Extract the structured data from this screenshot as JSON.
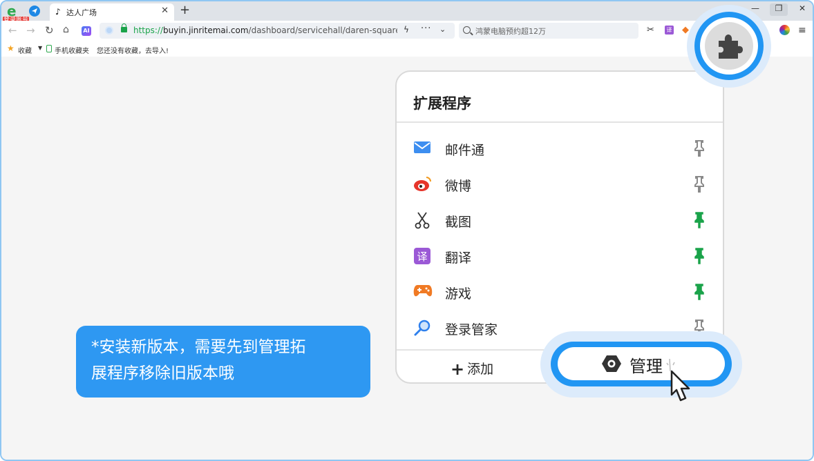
{
  "browser": {
    "login_badge": "登录账号",
    "tab": {
      "title": "达人广场"
    },
    "url": {
      "scheme": "https://",
      "host": "buyin.jinritemai.com",
      "path": "/dashboard/servicehall/daren-square?pre"
    },
    "search_query": "鸿蒙电脑预约超12万",
    "bookmarks": {
      "favorites": "收藏",
      "mobile": "手机收藏夹",
      "hint": "您还没有收藏，去导入!"
    }
  },
  "extensions_panel": {
    "title": "扩展程序",
    "items": [
      {
        "name": "邮件通",
        "icon": "mail-icon",
        "pinned": false
      },
      {
        "name": "微博",
        "icon": "weibo-icon",
        "pinned": false
      },
      {
        "name": "截图",
        "icon": "scissors-icon",
        "pinned": true
      },
      {
        "name": "翻译",
        "icon": "translate-icon",
        "pinned": true
      },
      {
        "name": "游戏",
        "icon": "gamepad-icon",
        "pinned": true
      },
      {
        "name": "登录管家",
        "icon": "key-icon",
        "pinned": false
      }
    ],
    "add_label": "添加",
    "manage_label": "管理"
  },
  "tooltip": {
    "line1": "*安装新版本，需要先到管理拓",
    "line2": "展程序移除旧版本哦"
  },
  "colors": {
    "accent": "#2196f3",
    "pinned": "#1aa34a",
    "unpinned": "#8a8a8a",
    "tooltip_bg": "#2e98f2"
  }
}
